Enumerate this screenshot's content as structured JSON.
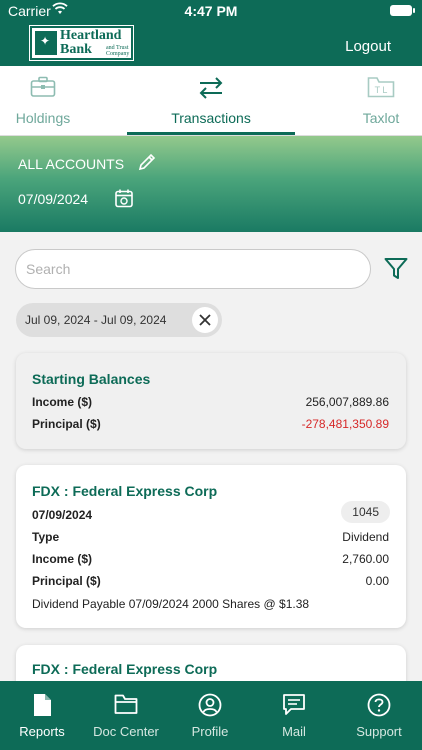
{
  "status_bar": {
    "carrier": "Carrier",
    "time": "4:47 PM"
  },
  "header": {
    "logo_name_line1": "Heartland",
    "logo_name_line2": "Bank",
    "logo_subtitle": "and Trust Company",
    "logout_label": "Logout"
  },
  "tabs": [
    {
      "label": "Holdings",
      "icon": "briefcase-icon",
      "active": false
    },
    {
      "label": "Transactions",
      "icon": "swap-arrows-icon",
      "active": true
    },
    {
      "label": "Taxlot",
      "icon": "taxlot-folder-icon",
      "icon_text": "T L",
      "active": false
    }
  ],
  "accounts": {
    "title": "ALL ACCOUNTS",
    "date": "07/09/2024"
  },
  "search": {
    "placeholder": "Search",
    "value": ""
  },
  "filter_chip": {
    "label": "Jul 09, 2024 - Jul 09, 2024"
  },
  "starting_balances": {
    "title": "Starting Balances",
    "rows": [
      {
        "label": "Income ($)",
        "value": "256,007,889.86"
      },
      {
        "label": "Principal ($)",
        "value": "-278,481,350.89"
      }
    ]
  },
  "transactions": [
    {
      "title": "FDX : Federal Express Corp",
      "date": "07/09/2024",
      "badge": "1045",
      "rows": [
        {
          "label": "Type",
          "value": "Dividend"
        },
        {
          "label": "Income ($)",
          "value": "2,760.00"
        },
        {
          "label": "Principal ($)",
          "value": "0.00"
        }
      ],
      "description": "Dividend Payable 07/09/2024 2000 Shares @ $1.38"
    },
    {
      "title": "FDX : Federal Express Corp"
    }
  ],
  "bottom_nav": [
    {
      "label": "Reports",
      "icon": "report-icon",
      "active": true
    },
    {
      "label": "Doc Center",
      "icon": "folder-icon",
      "active": false
    },
    {
      "label": "Profile",
      "icon": "user-circle-icon",
      "active": false
    },
    {
      "label": "Mail",
      "icon": "mail-chat-icon",
      "active": false
    },
    {
      "label": "Support",
      "icon": "help-icon",
      "active": false
    }
  ],
  "colors": {
    "brand": "#0d6b57",
    "negative": "#d62828",
    "tab_inactive": "#6fa89b"
  }
}
